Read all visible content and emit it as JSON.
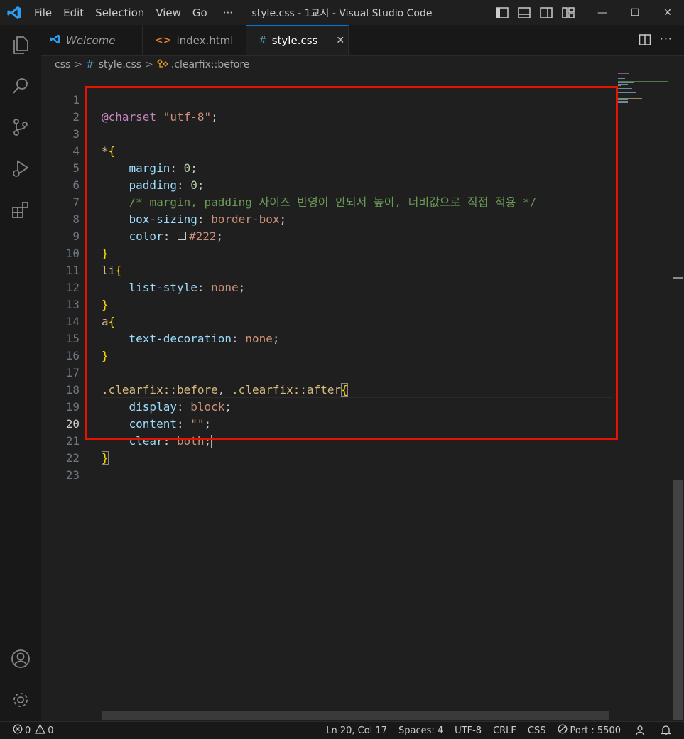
{
  "titlebar": {
    "menu": [
      "File",
      "Edit",
      "Selection",
      "View",
      "Go",
      "···"
    ],
    "window_title": "style.css - 1교시 - Visual Studio Code",
    "minimize": "—",
    "maximize": "☐",
    "close": "✕"
  },
  "tabs": [
    {
      "label": "Welcome",
      "icon": "vscode-icon"
    },
    {
      "label": "index.html",
      "icon": "html-icon"
    },
    {
      "label": "style.css",
      "icon": "css-hash-icon",
      "close": "✕"
    }
  ],
  "breadcrumbs": {
    "folder": "css",
    "file": "style.css",
    "symbol": ".clearfix::before",
    "sep": ">",
    "hash": "#"
  },
  "editor": {
    "line_numbers": [
      "1",
      "2",
      "3",
      "4",
      "5",
      "6",
      "7",
      "8",
      "9",
      "10",
      "11",
      "12",
      "13",
      "14",
      "15",
      "16",
      "17",
      "18",
      "19",
      "20",
      "21",
      "22",
      "23"
    ],
    "tokens": {
      "charset": "@charset",
      "charset_val": "\"utf-8\"",
      "semi": ";",
      "colon": ":",
      "comma": ",",
      "star": "*",
      "brace_open": "{",
      "brace_close": "}",
      "margin": "margin",
      "padding": "padding",
      "zero": "0",
      "comment": "/* margin, padding 사이즈 반영이 안되서 높이, 너비값으로 직접 적용 */",
      "box_sizing": "box-sizing",
      "border_box": "border-box",
      "color": "color",
      "color_val": "#222",
      "li": "li",
      "list_style": "list-style",
      "none": "none",
      "a": "a",
      "text_decoration": "text-decoration",
      "clearfix_before": ".clearfix::before",
      "clearfix_after": ".clearfix::after",
      "display": "display",
      "block": "block",
      "content": "content",
      "empty_str": "\"\"",
      "clear": "clear",
      "both": "both"
    },
    "colors": {
      "selection_box": "#e51400",
      "swatch": "#222222"
    }
  },
  "statusbar": {
    "errors": "0",
    "warnings": "0",
    "position": "Ln 20, Col 17",
    "spaces": "Spaces: 4",
    "encoding": "UTF-8",
    "eol": "CRLF",
    "language": "CSS",
    "port": "Port : 5500"
  }
}
